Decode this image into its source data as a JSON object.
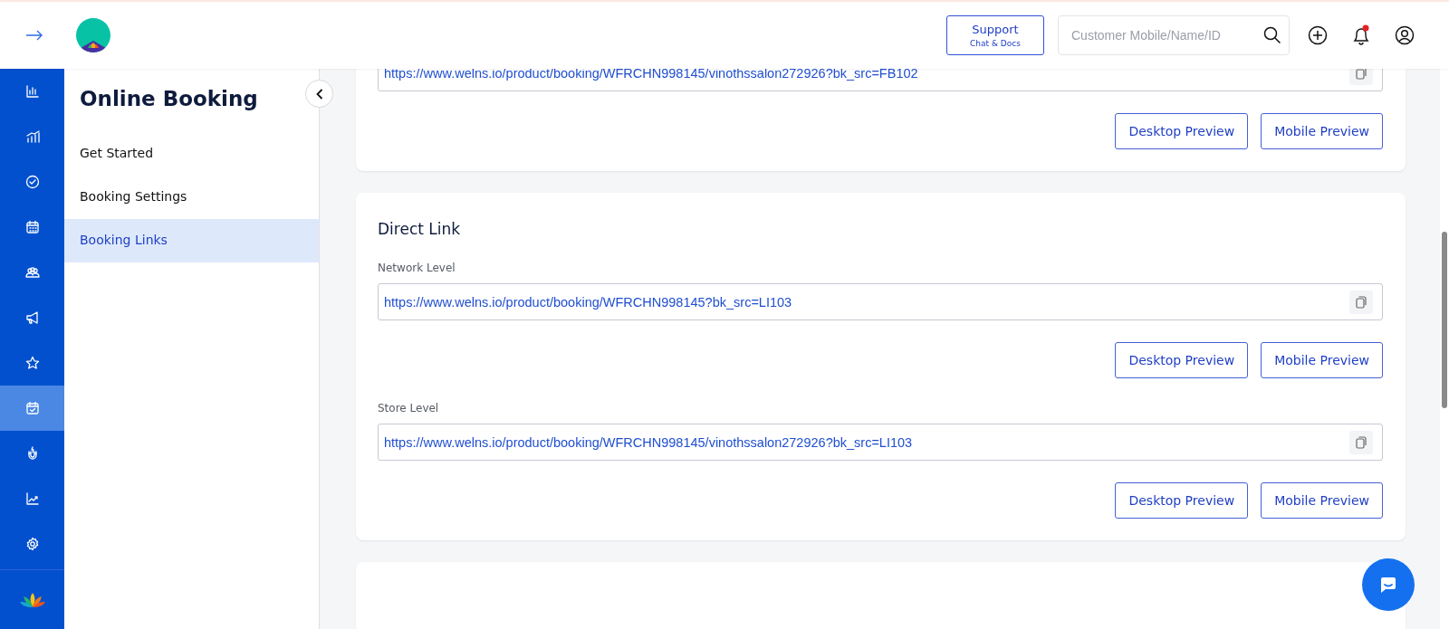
{
  "header": {
    "support_button": {
      "title": "Support",
      "subtitle": "Chat & Docs"
    },
    "search": {
      "placeholder": "Customer Mobile/Name/ID"
    },
    "notifications_unread": true
  },
  "rail": [
    {
      "kind": "bar-chart",
      "selected": false
    },
    {
      "kind": "growth-chart",
      "selected": false
    },
    {
      "kind": "check-circle",
      "selected": false
    },
    {
      "kind": "calendar",
      "selected": false
    },
    {
      "kind": "group",
      "selected": false
    },
    {
      "kind": "megaphone",
      "selected": false
    },
    {
      "kind": "star",
      "selected": false
    },
    {
      "kind": "calendar-check",
      "selected": true
    },
    {
      "kind": "magnet",
      "selected": false
    },
    {
      "kind": "trend",
      "selected": false
    },
    {
      "kind": "gear",
      "selected": false
    }
  ],
  "subnav": {
    "title": "Online Booking",
    "items": [
      {
        "label": "Get Started",
        "selected": false
      },
      {
        "label": "Booking Settings",
        "selected": false
      },
      {
        "label": "Booking Links",
        "selected": true
      }
    ]
  },
  "sections": [
    {
      "kind": "links",
      "links": [
        {
          "url": "https://www.welns.io/product/booking/WFRCHN998145/vinothssalon272926?bk_src=FB102",
          "buttons": [
            "Desktop Preview",
            "Mobile Preview"
          ]
        }
      ]
    },
    {
      "kind": "links",
      "title": "Direct Link",
      "links": [
        {
          "label": "Network Level",
          "url": "https://www.welns.io/product/booking/WFRCHN998145?bk_src=LI103",
          "buttons": [
            "Desktop Preview",
            "Mobile Preview"
          ]
        },
        {
          "label": "Store Level",
          "url": "https://www.welns.io/product/booking/WFRCHN998145/vinothssalon272926?bk_src=LI103",
          "buttons": [
            "Desktop Preview",
            "Mobile Preview"
          ]
        }
      ]
    },
    {
      "kind": "blank"
    }
  ]
}
